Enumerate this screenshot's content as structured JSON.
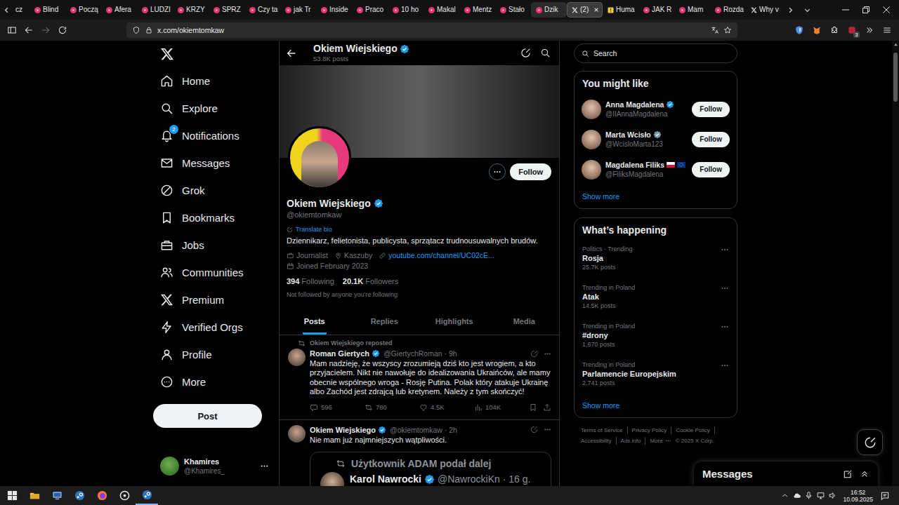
{
  "browser": {
    "tabs": [
      {
        "label": "cz",
        "kind": "partial",
        "selected": false,
        "hovered": false
      },
      {
        "label": "Blind",
        "kind": "youtube",
        "selected": false,
        "hovered": false
      },
      {
        "label": "Począ",
        "kind": "youtube",
        "selected": false,
        "hovered": false
      },
      {
        "label": "Afera",
        "kind": "youtube",
        "selected": false,
        "hovered": false
      },
      {
        "label": "LUDZI",
        "kind": "youtube",
        "selected": false,
        "hovered": false
      },
      {
        "label": "KRZY",
        "kind": "youtube",
        "selected": false,
        "hovered": false
      },
      {
        "label": "SPRZ",
        "kind": "youtube",
        "selected": false,
        "hovered": false
      },
      {
        "label": "Czy ta",
        "kind": "youtube",
        "selected": false,
        "hovered": false
      },
      {
        "label": "jak Tr",
        "kind": "youtube",
        "selected": false,
        "hovered": false
      },
      {
        "label": "Inside",
        "kind": "youtube",
        "selected": false,
        "hovered": false
      },
      {
        "label": "Praco",
        "kind": "youtube",
        "selected": false,
        "hovered": false
      },
      {
        "label": "10 ho",
        "kind": "youtube",
        "selected": false,
        "hovered": false
      },
      {
        "label": "Makal",
        "kind": "youtube",
        "selected": false,
        "hovered": false
      },
      {
        "label": "Mentz",
        "kind": "youtube",
        "selected": false,
        "hovered": false
      },
      {
        "label": "Stało",
        "kind": "youtube",
        "selected": false,
        "hovered": false
      },
      {
        "label": "Dzik",
        "kind": "youtube",
        "selected": false,
        "hovered": true
      },
      {
        "label": "(2)",
        "kind": "x",
        "selected": true,
        "hovered": false
      },
      {
        "label": "Huma",
        "kind": "note",
        "selected": false,
        "hovered": false
      },
      {
        "label": "JAK R",
        "kind": "youtube",
        "selected": false,
        "hovered": false
      },
      {
        "label": "Mam",
        "kind": "youtube",
        "selected": false,
        "hovered": false
      },
      {
        "label": "Rozda",
        "kind": "youtube",
        "selected": false,
        "hovered": false
      },
      {
        "label": "Why v",
        "kind": "x",
        "selected": false,
        "hovered": false
      }
    ],
    "forward_disabled": true,
    "address": "x.com/okiemtomkaw",
    "extension_badge": "3"
  },
  "nav": {
    "items": [
      {
        "label": "Home",
        "kind": "home",
        "selected": false
      },
      {
        "label": "Explore",
        "kind": "explore",
        "selected": false
      },
      {
        "label": "Notifications",
        "kind": "notifications",
        "selected": false,
        "badge": "2"
      },
      {
        "label": "Messages",
        "kind": "messages",
        "selected": false
      },
      {
        "label": "Grok",
        "kind": "grok",
        "selected": false
      },
      {
        "label": "Bookmarks",
        "kind": "bookmarks",
        "selected": false
      },
      {
        "label": "Jobs",
        "kind": "jobs",
        "selected": false
      },
      {
        "label": "Communities",
        "kind": "communities",
        "selected": false
      },
      {
        "label": "Premium",
        "kind": "premium",
        "selected": false
      },
      {
        "label": "Verified Orgs",
        "kind": "verified",
        "selected": false
      },
      {
        "label": "Profile",
        "kind": "profile",
        "selected": false
      },
      {
        "label": "More",
        "kind": "more",
        "selected": false
      }
    ],
    "post_button": "Post",
    "account": {
      "name": "Khamires",
      "handle": "@Khamires_"
    }
  },
  "profile": {
    "header": {
      "name": "Okiem Wiejskiego",
      "posts": "53.8K posts"
    },
    "name": "Okiem Wiejskiego",
    "verified": true,
    "handle": "@okiemtomkaw",
    "follow_button": "Follow",
    "translate": "Translate bio",
    "bio": "Dziennikarz, felietonista, publicysta, sprzątacz trudnousuwalnych brudów.",
    "meta": [
      {
        "kind": "category",
        "text": "Journalist"
      },
      {
        "kind": "location",
        "text": "Kaszuby"
      },
      {
        "kind": "link",
        "text": "youtube.com/channel/UC02cE..."
      },
      {
        "kind": "joined",
        "text": "Joined February 2023"
      }
    ],
    "stats": [
      {
        "value": "394",
        "label": "Following"
      },
      {
        "value": "20.1K",
        "label": "Followers"
      }
    ],
    "followed_by": "Not followed by anyone you’re following",
    "tabs": [
      {
        "label": "Posts",
        "selected": true
      },
      {
        "label": "Replies",
        "selected": false
      },
      {
        "label": "Highlights",
        "selected": false
      },
      {
        "label": "Media",
        "selected": false
      }
    ]
  },
  "posts": [
    {
      "repost_label": "Okiem Wiejskiego reposted",
      "author": "Roman Giertych",
      "verified": true,
      "byline": "@GiertychRoman · 9h",
      "text": "Mam nadzieję, że wszyscy zrozumieją dziś kto jest wrogiem, a kto przyjacielem. Nikt nie nawołuje do idealizowania Ukraińców, ale mamy obecnie wspólnego wroga - Rosję Putina. Polak który atakuje Ukrainę albo Zachód jest zdrajcą lub kretynem. Należy z tym skończyć!",
      "stats": [
        {
          "kind": "reply",
          "count": "596"
        },
        {
          "kind": "repost",
          "count": "780"
        },
        {
          "kind": "like",
          "count": "4.5K"
        },
        {
          "kind": "views",
          "count": "104K"
        }
      ]
    },
    {
      "repost_label": "",
      "author": "Okiem Wiejskiego",
      "verified": true,
      "byline": "@okiemtomkaw · 2h",
      "text": "Nie mam już najmniejszych wątpliwości.",
      "stats": [],
      "embed": {
        "repost_label": "Użytkownik ADAM podał dalej",
        "author": "Karol Nawrocki",
        "verified": true,
        "byline": "@NawrockiKn · 16 g."
      }
    }
  ],
  "sidebar": {
    "search": {
      "placeholder": "Search"
    },
    "suggestions": {
      "title": "You might like",
      "users": [
        {
          "name": "Anna Magdalena",
          "handle": "@IIAnnaMagdalena",
          "verified": true,
          "badge_color": "#1d9bf0",
          "flags": [],
          "button": "Follow"
        },
        {
          "name": "Marta Wcisło",
          "handle": "@WcisloMarta123",
          "verified": true,
          "badge_color": "#829aab",
          "flags": [],
          "button": "Follow"
        },
        {
          "name": "Magdalena Filiks",
          "handle": "@FiliksMagdalena",
          "verified": false,
          "badge_color": "",
          "flags": [
            "PL",
            "EU"
          ],
          "button": "Follow"
        }
      ],
      "show_more": "Show more"
    },
    "trends": {
      "title": "What’s happening",
      "items": [
        {
          "context": "Politics · Trending",
          "name": "Rosja",
          "count": "25.7K posts"
        },
        {
          "context": "Trending in Poland",
          "name": "Atak",
          "count": "14.5K posts"
        },
        {
          "context": "Trending in Poland",
          "name": "#drony",
          "count": "1,670 posts"
        },
        {
          "context": "Trending in Poland",
          "name": "Parlamencie Europejskim",
          "count": "2,741 posts"
        }
      ],
      "show_more": "Show more"
    },
    "footer": [
      "Terms of Service",
      "Privacy Policy",
      "Cookie Policy",
      "Accessibility",
      "Ads info",
      "More",
      "© 2025 X Corp."
    ]
  },
  "messages_drawer": {
    "title": "Messages"
  },
  "taskbar": {
    "time": "16:52",
    "date": "10.09.2025"
  }
}
